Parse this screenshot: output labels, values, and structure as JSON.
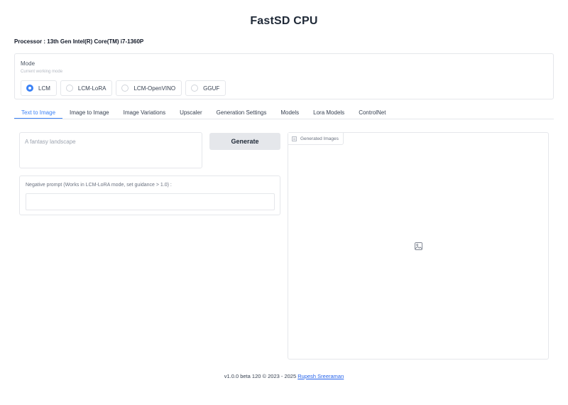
{
  "app": {
    "title": "FastSD CPU",
    "processor": "Processor : 13th Gen Intel(R) Core(TM) i7-1360P"
  },
  "mode": {
    "label": "Mode",
    "info": "Current working mode",
    "options": [
      "LCM",
      "LCM-LoRA",
      "LCM-OpenVINO",
      "GGUF"
    ],
    "selected": "LCM"
  },
  "tabs": [
    "Text to Image",
    "Image to Image",
    "Image Variations",
    "Upscaler",
    "Generation Settings",
    "Models",
    "Lora Models",
    "ControlNet"
  ],
  "active_tab": "Text to Image",
  "prompt": {
    "value": "",
    "placeholder": "A fantasy landscape"
  },
  "generate_label": "Generate",
  "negative_prompt": {
    "label": "Negative prompt (Works in LCM-LoRA mode, set guidance > 1.0) :",
    "value": ""
  },
  "gallery": {
    "label": "Generated Images"
  },
  "footer": {
    "version": "v1.0.0 beta 120 © 2023 - 2025",
    "author": "Rupesh Sreeraman"
  },
  "colors": {
    "accent": "#3b82f6",
    "button_bg": "#e5e7eb",
    "link": "#2563eb"
  },
  "icons": {
    "gallery_label": "image-gallery-icon",
    "gallery_placeholder": "image-icon"
  }
}
